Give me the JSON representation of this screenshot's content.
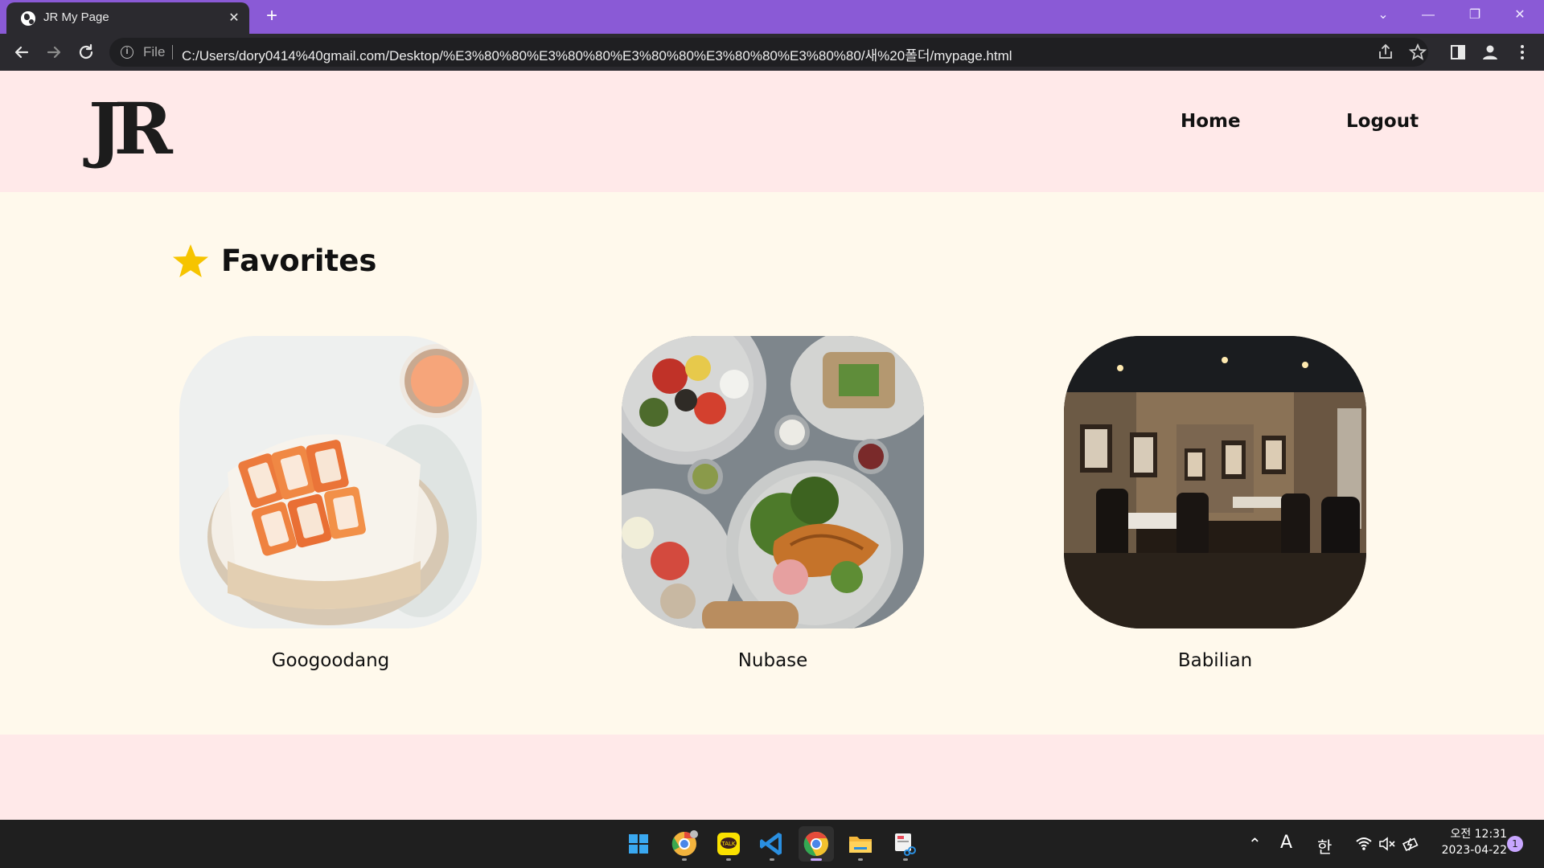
{
  "browser": {
    "tab_title": "JR My Page",
    "close_icon": "close-icon",
    "new_tab_icon": "plus-icon",
    "url_scheme": "File",
    "url": "C:/Users/dory0414%40gmail.com/Desktop/%E3%80%80%E3%80%80%E3%80%80%E3%80%80%E3%80%80/새%20폴더/mypage.html",
    "accent_color": "#8a5ad6"
  },
  "header": {
    "logo": "JR",
    "nav": [
      {
        "label": "Home"
      },
      {
        "label": "Logout"
      }
    ]
  },
  "favorites": {
    "title": "Favorites",
    "icon": "star-icon",
    "star_color": "#f6c400",
    "items": [
      {
        "name": "Googoodang",
        "image": "shrimp-toast-photo"
      },
      {
        "name": "Nubase",
        "image": "salad-croissant-photo"
      },
      {
        "name": "Babilian",
        "image": "restaurant-interior-photo"
      }
    ]
  },
  "colors": {
    "header_bg": "#ffe9e9",
    "main_bg": "#fff9ec",
    "footer_bg": "#ffe9e9"
  },
  "taskbar": {
    "apps": [
      "start-icon",
      "chrome-canary-icon",
      "kakaotalk-icon",
      "vscode-icon",
      "chrome-icon",
      "file-explorer-icon",
      "snipping-tool-icon"
    ],
    "ime_letter": "A",
    "ime_lang": "한",
    "time": "오전 12:31",
    "date": "2023-04-22",
    "notification_count": "1"
  }
}
